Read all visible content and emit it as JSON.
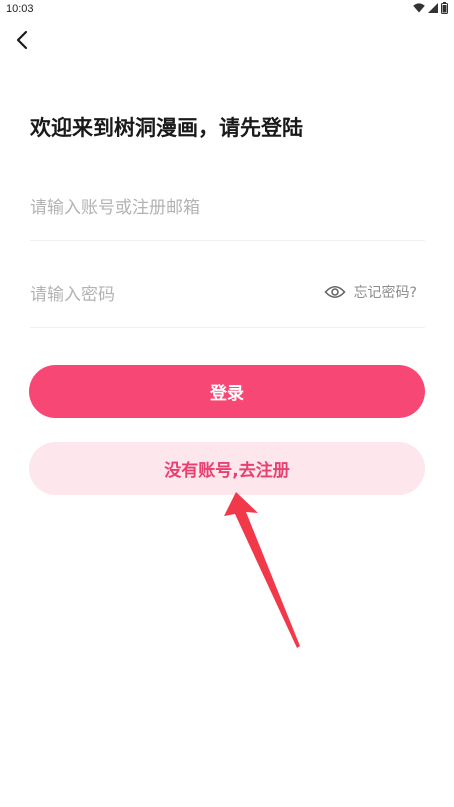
{
  "status_bar": {
    "time": "10:03",
    "icons": [
      "wifi-icon",
      "signal-icon",
      "battery-icon"
    ]
  },
  "header": {
    "back_icon": "chevron-left-icon"
  },
  "login_form": {
    "title": "欢迎来到树洞漫画，请先登陆",
    "account_input": {
      "value": "",
      "placeholder": "请输入账号或注册邮箱"
    },
    "password_input": {
      "value": "",
      "placeholder": "请输入密码"
    },
    "password_toggle_icon": "eye-icon",
    "forgot_password_label": "忘记密码?",
    "login_button_label": "登录",
    "register_button_label": "没有账号,去注册"
  },
  "annotation": {
    "arrow_icon": "red-arrow-icon"
  },
  "colors": {
    "accent": "#f74775",
    "accent_light": "#fde6ec",
    "accent_text": "#e84171",
    "arrow": "#f2394a",
    "placeholder": "#b3b3b3",
    "divider": "#f0f0f0"
  }
}
